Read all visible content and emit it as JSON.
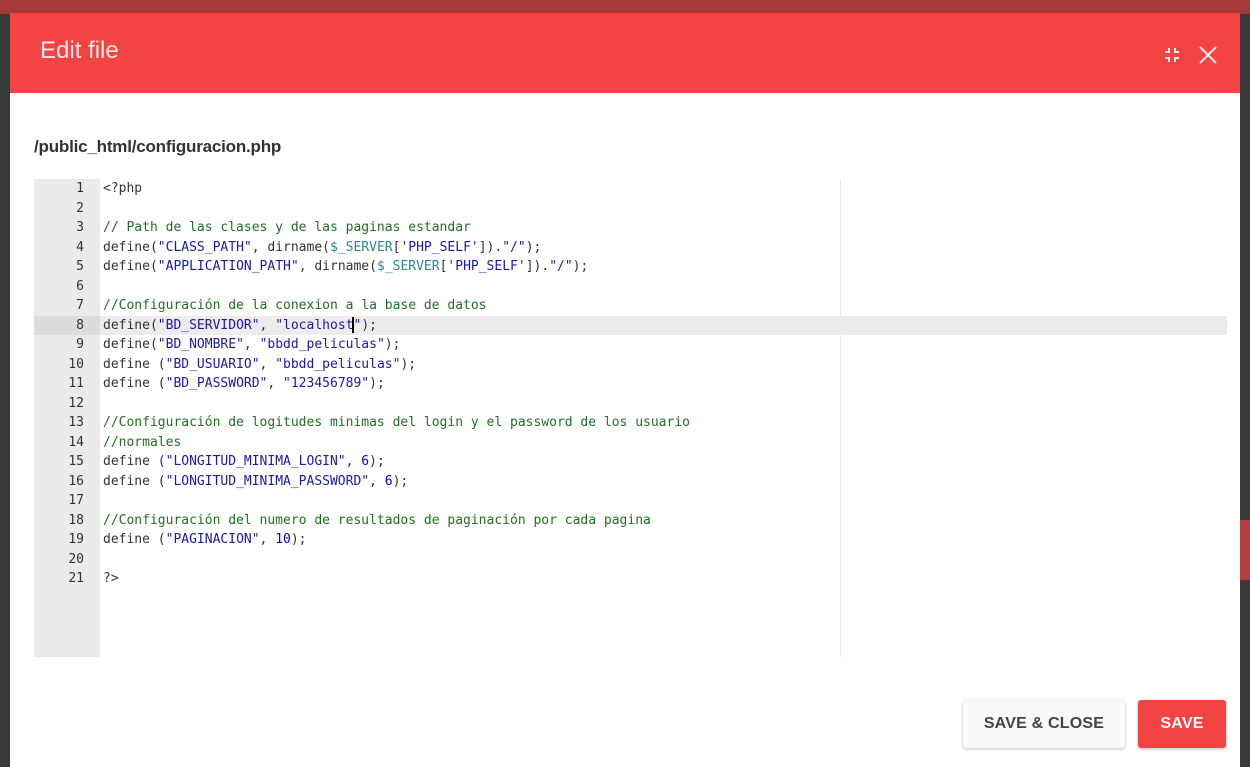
{
  "modal": {
    "title": "Edit file",
    "file_path": "/public_html/configuracion.php",
    "header_color": "#f44343"
  },
  "header_icons": {
    "fullscreen": "fullscreen-icon",
    "close": "close-icon"
  },
  "editor": {
    "active_line": 8,
    "lines": [
      {
        "n": "1",
        "segments": [
          {
            "t": "<?php",
            "c": "kw"
          }
        ]
      },
      {
        "n": "2",
        "segments": []
      },
      {
        "n": "3",
        "segments": [
          {
            "t": "// Path de las clases y de las paginas estandar",
            "c": "cm"
          }
        ]
      },
      {
        "n": "4",
        "segments": [
          {
            "t": "define(",
            "c": "kw"
          },
          {
            "t": "\"CLASS_PATH\"",
            "c": "st"
          },
          {
            "t": ", dirname(",
            "c": "kw"
          },
          {
            "t": "$_SERVER",
            "c": "vr"
          },
          {
            "t": "[",
            "c": "kw"
          },
          {
            "t": "'PHP_SELF'",
            "c": "st"
          },
          {
            "t": "]).",
            "c": "kw"
          },
          {
            "t": "\"/\"",
            "c": "st"
          },
          {
            "t": ");",
            "c": "kw"
          }
        ]
      },
      {
        "n": "5",
        "segments": [
          {
            "t": "define(",
            "c": "kw"
          },
          {
            "t": "\"APPLICATION_PATH\"",
            "c": "st"
          },
          {
            "t": ", dirname(",
            "c": "kw"
          },
          {
            "t": "$_SERVER",
            "c": "vr"
          },
          {
            "t": "[",
            "c": "kw"
          },
          {
            "t": "'PHP_SELF'",
            "c": "st"
          },
          {
            "t": "]).",
            "c": "kw"
          },
          {
            "t": "\"/\"",
            "c": "st"
          },
          {
            "t": ");",
            "c": "kw"
          }
        ]
      },
      {
        "n": "6",
        "segments": []
      },
      {
        "n": "7",
        "segments": [
          {
            "t": "//Configuración de la conexion a la base de datos",
            "c": "cm"
          }
        ]
      },
      {
        "n": "8",
        "segments": [
          {
            "t": "define(",
            "c": "kw"
          },
          {
            "t": "\"BD_SERVIDOR\"",
            "c": "st"
          },
          {
            "t": ", ",
            "c": "kw"
          },
          {
            "t": "\"localhost",
            "c": "st"
          },
          {
            "t": "|CURSOR|",
            "c": "cursor"
          },
          {
            "t": "\"",
            "c": "st"
          },
          {
            "t": ");",
            "c": "kw"
          }
        ]
      },
      {
        "n": "9",
        "segments": [
          {
            "t": "define(",
            "c": "kw"
          },
          {
            "t": "\"BD_NOMBRE\"",
            "c": "st"
          },
          {
            "t": ", ",
            "c": "kw"
          },
          {
            "t": "\"bbdd_peliculas\"",
            "c": "st"
          },
          {
            "t": ");",
            "c": "kw"
          }
        ]
      },
      {
        "n": "10",
        "segments": [
          {
            "t": "define (",
            "c": "kw"
          },
          {
            "t": "\"BD_USUARIO\"",
            "c": "st"
          },
          {
            "t": ", ",
            "c": "kw"
          },
          {
            "t": "\"bbdd_peliculas\"",
            "c": "st"
          },
          {
            "t": ");",
            "c": "kw"
          }
        ]
      },
      {
        "n": "11",
        "segments": [
          {
            "t": "define (",
            "c": "kw"
          },
          {
            "t": "\"BD_PASSWORD\"",
            "c": "st"
          },
          {
            "t": ", ",
            "c": "kw"
          },
          {
            "t": "\"123456789\"",
            "c": "st"
          },
          {
            "t": ");",
            "c": "kw"
          }
        ]
      },
      {
        "n": "12",
        "segments": []
      },
      {
        "n": "13",
        "segments": [
          {
            "t": "//Configuración de logitudes minimas del login y el password de los usuario",
            "c": "cm"
          }
        ]
      },
      {
        "n": "14",
        "segments": [
          {
            "t": "//normales",
            "c": "cm"
          }
        ]
      },
      {
        "n": "15",
        "segments": [
          {
            "t": "define (",
            "c": "kw"
          },
          {
            "t": "\"LONGITUD_MINIMA_LOGIN\"",
            "c": "st"
          },
          {
            "t": ", ",
            "c": "kw"
          },
          {
            "t": "6",
            "c": "nu"
          },
          {
            "t": ");",
            "c": "kw"
          }
        ]
      },
      {
        "n": "16",
        "segments": [
          {
            "t": "define (",
            "c": "kw"
          },
          {
            "t": "\"LONGITUD_MINIMA_PASSWORD\"",
            "c": "st"
          },
          {
            "t": ", ",
            "c": "kw"
          },
          {
            "t": "6",
            "c": "nu"
          },
          {
            "t": ");",
            "c": "kw"
          }
        ]
      },
      {
        "n": "17",
        "segments": []
      },
      {
        "n": "18",
        "segments": [
          {
            "t": "//Configuración del numero de resultados de paginación por cada pagina",
            "c": "cm"
          }
        ]
      },
      {
        "n": "19",
        "segments": [
          {
            "t": "define (",
            "c": "kw"
          },
          {
            "t": "\"PAGINACION\"",
            "c": "st"
          },
          {
            "t": ", ",
            "c": "kw"
          },
          {
            "t": "10",
            "c": "nu"
          },
          {
            "t": ");",
            "c": "kw"
          }
        ]
      },
      {
        "n": "20",
        "segments": []
      },
      {
        "n": "21",
        "segments": [
          {
            "t": "?>",
            "c": "kw"
          }
        ]
      }
    ]
  },
  "buttons": {
    "save_close": "SAVE & CLOSE",
    "save": "SAVE"
  }
}
